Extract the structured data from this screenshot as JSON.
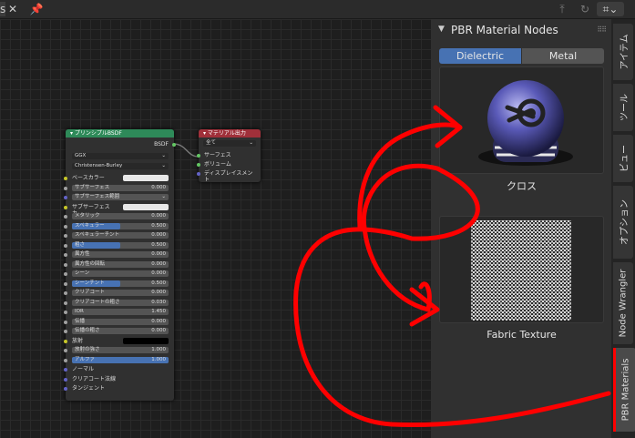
{
  "sidebar_panel": {
    "title": "PBR Material Nodes",
    "tabs": [
      {
        "label": "Dielectric",
        "active": true
      },
      {
        "label": "Metal",
        "active": false
      }
    ],
    "previews": [
      {
        "caption": "クロス"
      },
      {
        "caption": "Fabric Texture"
      }
    ]
  },
  "vertical_tabs": [
    "アイテム",
    "ツール",
    "ビュー",
    "オプション",
    "Node Wrangler",
    "PBR Materials"
  ],
  "bsdf_node": {
    "title": "プリンシプルBSDF",
    "output": "BSDF",
    "distribution": "GGX",
    "subsurface_method": "Christensen-Burley",
    "rows": [
      {
        "label": "ベースカラー",
        "type": "color"
      },
      {
        "label": "サブサーフェス",
        "value": "0.000",
        "type": "field"
      },
      {
        "label": "サブサーフェス範囲",
        "type": "dropdown"
      },
      {
        "label": "サブサーフェスカ...",
        "type": "color"
      },
      {
        "label": "メタリック",
        "value": "0.000",
        "type": "field"
      },
      {
        "label": "スペキュラー",
        "value": "0.500",
        "type": "slider",
        "fill": 0.5
      },
      {
        "label": "スペキュラーチント",
        "value": "0.000",
        "type": "field"
      },
      {
        "label": "粗さ",
        "value": "0.500",
        "type": "slider",
        "fill": 0.5
      },
      {
        "label": "異方性",
        "value": "0.000",
        "type": "field"
      },
      {
        "label": "異方性の回転",
        "value": "0.000",
        "type": "field"
      },
      {
        "label": "シーン",
        "value": "0.000",
        "type": "field"
      },
      {
        "label": "シーンチント",
        "value": "0.500",
        "type": "slider",
        "fill": 0.5
      },
      {
        "label": "クリアコート",
        "value": "0.000",
        "type": "field"
      },
      {
        "label": "クリアコートの粗さ",
        "value": "0.030",
        "type": "field"
      },
      {
        "label": "IOR",
        "value": "1.450",
        "type": "field"
      },
      {
        "label": "伝播",
        "value": "0.000",
        "type": "field"
      },
      {
        "label": "伝播の粗さ",
        "value": "0.000",
        "type": "field"
      },
      {
        "label": "放射",
        "type": "black"
      },
      {
        "label": "放射の強さ",
        "value": "1.000",
        "type": "field"
      },
      {
        "label": "アルファ",
        "value": "1.000",
        "type": "slider",
        "fill": 1.0
      },
      {
        "label": "ノーマル",
        "type": "socket"
      },
      {
        "label": "クリアコート法線",
        "type": "socket"
      },
      {
        "label": "タンジェント",
        "type": "socket"
      }
    ]
  },
  "output_node": {
    "title": "マテリアル出力",
    "target": "全て",
    "inputs": [
      "サーフェス",
      "ボリューム",
      "ディスプレイスメント"
    ]
  },
  "colors": {
    "accent_blue": "#4772b3",
    "bsdf_header": "#2e8a59",
    "output_header": "#a0303a",
    "annotation_red": "#ff0000"
  }
}
